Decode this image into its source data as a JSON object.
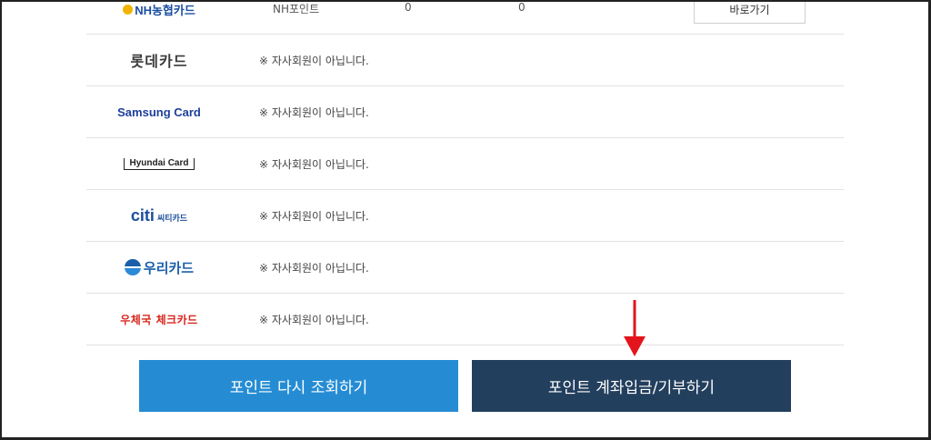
{
  "top_row": {
    "logo": "NH농협카드",
    "point_name": "NH포인트",
    "value1": "0",
    "value2": "0",
    "go_button": "바로가기"
  },
  "cards": [
    {
      "name": "롯데카드",
      "logo_text": "롯데카드",
      "message": "※ 자사회원이 아닙니다."
    },
    {
      "name": "Samsung Card",
      "logo_text": "Samsung Card",
      "message": "※ 자사회원이 아닙니다."
    },
    {
      "name": "Hyundai Card",
      "logo_text": "Hyundai Card",
      "message": "※ 자사회원이 아닙니다."
    },
    {
      "name": "citi 씨티카드",
      "logo_text": "citi",
      "logo_sub": "씨티카드",
      "message": "※ 자사회원이 아닙니다."
    },
    {
      "name": "우리카드",
      "logo_text": "우리카드",
      "message": "※ 자사회원이 아닙니다."
    },
    {
      "name": "우체국 체크카드",
      "logo_text": "우체국 체크카드",
      "message": "※ 자사회원이 아닙니다."
    }
  ],
  "buttons": {
    "refresh": "포인트 다시 조회하기",
    "deposit": "포인트 계좌입금/기부하기"
  },
  "colors": {
    "refresh_button": "#258cd4",
    "deposit_button": "#233f5e",
    "arrow": "#e3141b"
  }
}
